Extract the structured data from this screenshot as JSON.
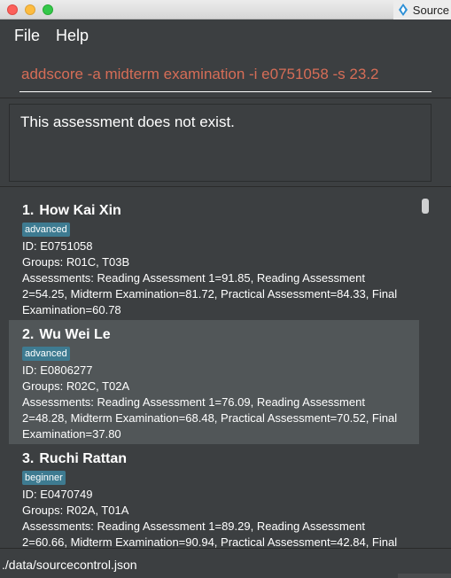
{
  "window": {
    "app_title": "Source",
    "icon": "diamond-app-icon"
  },
  "menu": {
    "file": "File",
    "help": "Help"
  },
  "command": {
    "value": "addscore -a midterm examination -i e0751058 -s 23.2"
  },
  "result": {
    "text": "This assessment does not exist."
  },
  "students": [
    {
      "index": "1.",
      "name": "How Kai Xin",
      "tag": "advanced",
      "id": "ID: E0751058",
      "groups": "Groups: R01C, T03B",
      "assessments": "Assessments: Reading Assessment 1=91.85, Reading Assessment 2=54.25, Midterm Examination=81.72, Practical Assessment=84.33, Final Examination=60.78"
    },
    {
      "index": "2.",
      "name": "Wu Wei Le",
      "tag": "advanced",
      "id": "ID: E0806277",
      "groups": "Groups: R02C, T02A",
      "assessments": "Assessments: Reading Assessment 1=76.09, Reading Assessment 2=48.28, Midterm Examination=68.48, Practical Assessment=70.52, Final Examination=37.80"
    },
    {
      "index": "3.",
      "name": "Ruchi Rattan",
      "tag": "beginner",
      "id": "ID: E0470749",
      "groups": "Groups: R02A, T01A",
      "assessments": "Assessments: Reading Assessment 1=89.29, Reading Assessment 2=60.66, Midterm Examination=90.94, Practical Assessment=42.84, Final"
    }
  ],
  "status": {
    "path": "./data/sourcecontrol.json"
  },
  "colors": {
    "background": "#3c3f41",
    "command_text": "#d66d57",
    "tag": "#3e7b91",
    "selected_row": "#515658"
  }
}
